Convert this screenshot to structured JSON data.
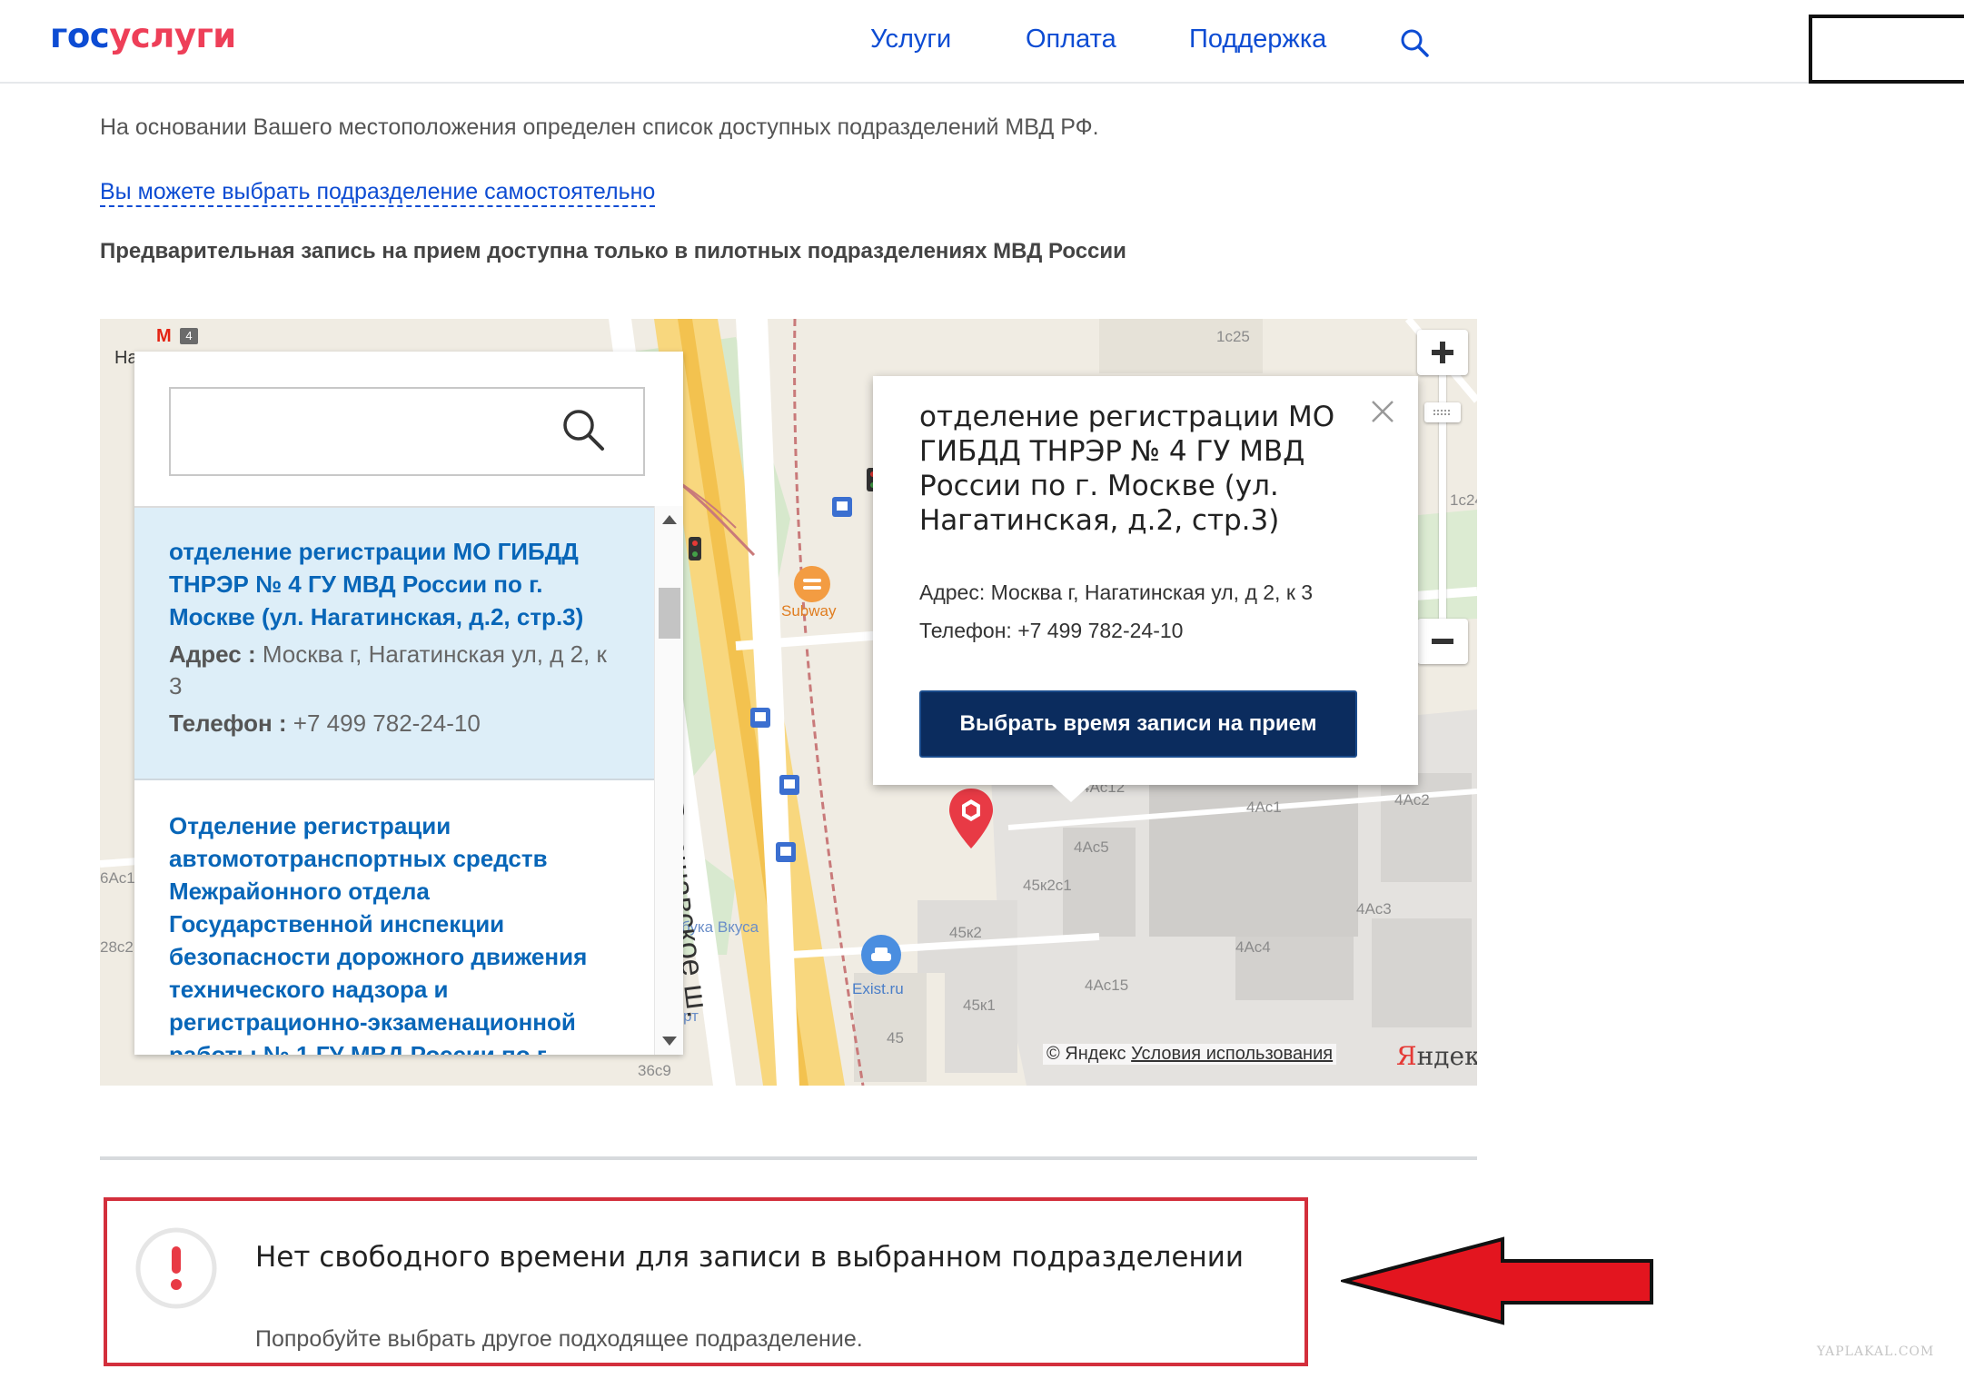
{
  "header": {
    "logo_gos": "гос",
    "logo_uslugi": "услуги",
    "nav": {
      "services": "Услуги",
      "payment": "Оплата",
      "support": "Поддержка"
    }
  },
  "content": {
    "info_text": "На основании Вашего местоположения определен список доступных подразделений МВД РФ.",
    "choose_link": "Вы можете выбрать подразделение самостоятельно",
    "notice": "Предварительная запись на прием доступна только в пилотных подразделениях МВД России"
  },
  "map": {
    "street_label": "Варшавское ш.",
    "poi_subway": "Subway",
    "poi_exist": "Exist.ru",
    "poi_azbuka": "бука Вкуса",
    "metro_line": "4",
    "labels": {
      "b1c25": "1с25",
      "b1c2": "1с24",
      "b4ac12": "4Ас12",
      "b4ac1": "4Ас1",
      "b4ac2": "4Ас2",
      "b4ac5": "4Ас5",
      "b45k2c1": "45к2с1",
      "b45k2": "45к2",
      "b4ac3": "4Ас3",
      "b4ac4": "4Ас4",
      "b4ac15": "4Ас15",
      "b45k1": "45к1",
      "b45": "45",
      "b36c9": "36с9",
      "b6ac1": "6Ас1",
      "b28c2": "28с2",
      "na": "На",
      "pt": "рт"
    },
    "copyright_prefix": "© Яндекс",
    "copyright_link": "Условия использования",
    "logo_y": "Я",
    "logo_rest": "ндекс"
  },
  "panel": {
    "search_value": "",
    "items": [
      {
        "title": "отделение регистрации МО ГИБДД ТНРЭР № 4 ГУ МВД России по г. Москве (ул. Нагатинская, д.2, стр.3)",
        "address_label": "Адрес :",
        "address": "Москва г, Нагатинская ул, д 2, к 3",
        "phone_label": "Телефон :",
        "phone": "+7 499 782-24-10"
      },
      {
        "title": "Отделение регистрации автомототранспортных средств Межрайонного отдела Государственной инспекции безопасности дорожного движения технического надзора и регистрационно-экзаменационной работы № 1 ГУ МВД России по г."
      }
    ]
  },
  "popup": {
    "title": "отделение регистрации МО ГИБДД ТНРЭР № 4 ГУ МВД России по г. Москве (ул. Нагатинская, д.2, стр.3)",
    "address": "Адрес: Москва г, Нагатинская ул, д 2, к 3",
    "phone": "Телефон: +7 499 782-24-10",
    "button": "Выбрать время записи на прием"
  },
  "error": {
    "title": "Нет свободного времени для записи в выбранном подразделении",
    "subtitle": "Попробуйте выбрать другое подходящее подразделение."
  },
  "watermark": "YAPLAKAL.COM",
  "colors": {
    "brand_blue": "#0d4cd3",
    "brand_red": "#ee3f58",
    "button_navy": "#0b2c5e",
    "error_red": "#d32f3c"
  }
}
